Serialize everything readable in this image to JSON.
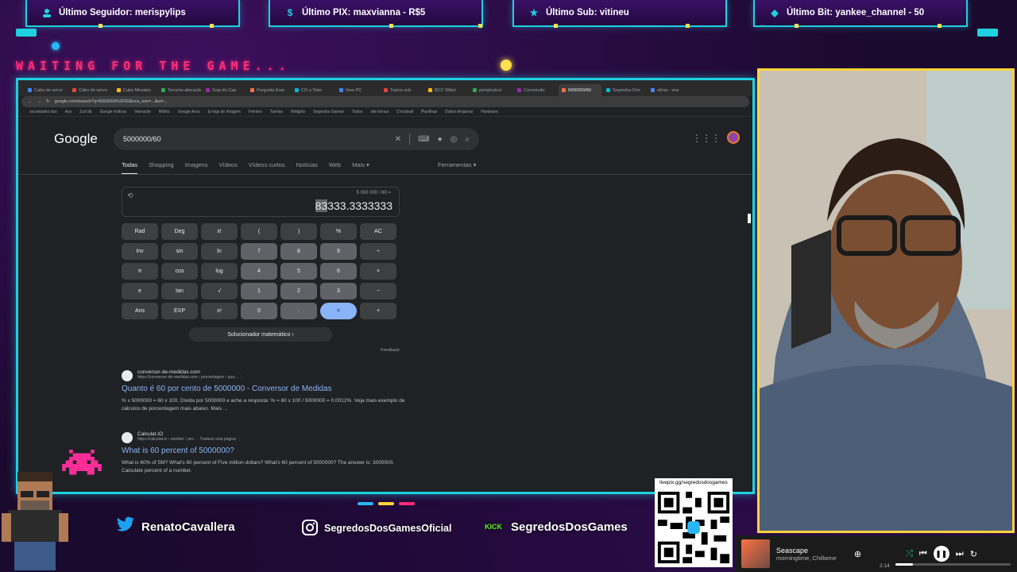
{
  "alerts": [
    {
      "label": "Último Seguidor: merispylips",
      "icon": "user-icon"
    },
    {
      "label": "Último PIX: maxvianna - R$5",
      "icon": "dollar-icon"
    },
    {
      "label": "Último Sub: vitineu",
      "icon": "star-icon"
    },
    {
      "label": "Último Bit: yankee_channel - 50",
      "icon": "diamond-icon"
    }
  ],
  "waiting_text": "WAITING FOR THE GAME...",
  "browser": {
    "tabs": [
      "Cabo de servo",
      "Cabo de servo",
      "Cabo Mosalec",
      "Terceira alteração",
      "Soja do Cap",
      "Pergunta Eras",
      "CO o Tebo",
      "New PC",
      "Topico sub",
      "BCC Wikel",
      "portalcalcul",
      "Conversão",
      "5000000/60",
      "Segredos Dos",
      "ultras - sea"
    ],
    "url": "google.com/search?q=5000000%2F60&sca_esv=...&ei=...",
    "bookmarks": [
      "sociedades dos",
      "Ayo",
      "Zurt lib",
      "Google Indicou",
      "Interactie",
      "Wikho",
      "Google Area",
      "Ip logs de Imagem",
      "Frentes",
      "Tarefas",
      "Widgets",
      "Segredos Games",
      "Todos",
      "site bonus",
      "Crossball",
      "Planilhas",
      "Dados Arquivos",
      "Hardware"
    ]
  },
  "google": {
    "logo": "Google",
    "query": "5000000/60",
    "tabs": [
      "Todas",
      "Shopping",
      "Imagens",
      "Vídeos",
      "Vídeos curtos",
      "Notícias",
      "Web",
      "Mais ▾"
    ],
    "tools": "Ferramentas ▾"
  },
  "calculator": {
    "expression": "5 000 000 / 60 =",
    "result_highlight": "83",
    "result_rest": "333.3333333",
    "buttons": [
      "Rad",
      "Deg",
      "x!",
      "(",
      ")",
      "%",
      "AC",
      "Inv",
      "sin",
      "ln",
      "7",
      "8",
      "9",
      "÷",
      "π",
      "cos",
      "log",
      "4",
      "5",
      "6",
      "×",
      "e",
      "tan",
      "√",
      "1",
      "2",
      "3",
      "−",
      "Ans",
      "EXP",
      "xʸ",
      "0",
      ".",
      "=",
      "+"
    ],
    "solver": "Solucionador matemático  ›",
    "feedback": "Feedback"
  },
  "results": [
    {
      "site": "conversor-de-medidas.com",
      "url": "https://conversor-de-medidas.com › porcentagem › qua...  ⋮",
      "title": "Quanto é 60 por cento de 5000000 - Conversor de Medidas",
      "snippet": "% x 5000000 = 60 x 100. Divida por 5000000 e ache a resposta: % = 60 x 100 / 5000000 = 0.0012%. Veja mais exemplo de cálculos de porcentagem mais abaixo. Mais ..."
    },
    {
      "site": "Calculat.IO",
      "url": "https://calculat.io › number › per...  · Traduzir esta página  ⋮",
      "title": "What is 60 percent of 5000000?",
      "snippet": "What is 60% of 5M? What's 60 percent of Five million dollars? What's 60 percent of 5000000? The answer is: 3000000. Calculate percent of a number."
    }
  ],
  "social": {
    "twitter": "RenatoCavallera",
    "instagram": "SegredosDosGamesOficial",
    "kick_badge": "KICK",
    "kick": "SegredosDosGames",
    "livepix": "livepix.gg/segredosdosgames"
  },
  "player": {
    "song": "Seascape",
    "artist": "morningtime, Chillwme",
    "time": "2:14",
    "progress": 0.15
  },
  "colors": {
    "frame": "#1dd1e0",
    "webcam_border": "#ffd43b",
    "accent_pink": "#ff2d78"
  }
}
